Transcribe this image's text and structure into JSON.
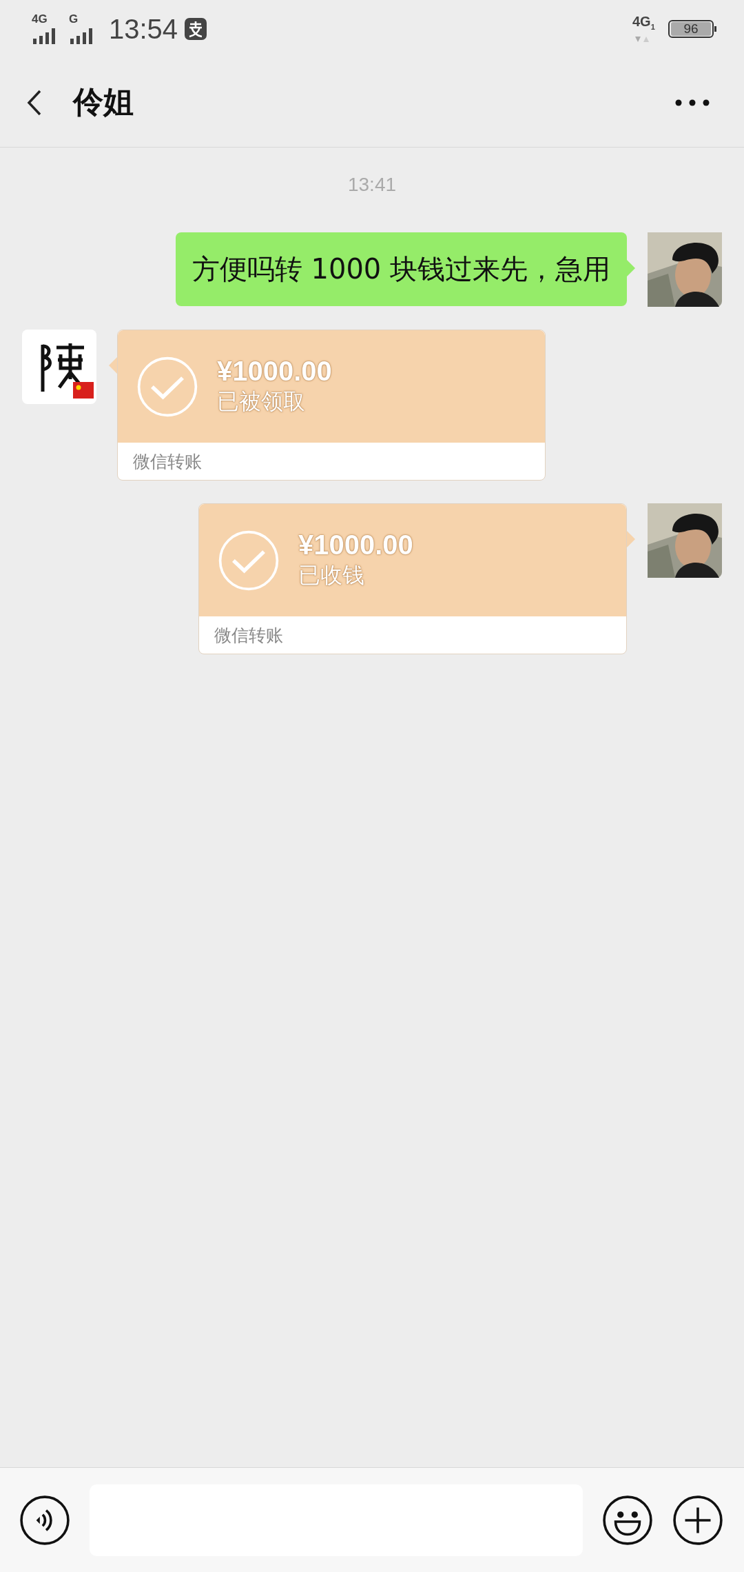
{
  "status_bar": {
    "network_1": "4G",
    "network_2": "G",
    "time": "13:54",
    "network_right": "4G",
    "network_right_sub": "1",
    "battery": "96"
  },
  "header": {
    "title": "伶姐"
  },
  "timestamp": "13:41",
  "messages": [
    {
      "kind": "text",
      "outgoing": true,
      "text": "方便吗转 1000 块钱过来先，急用"
    },
    {
      "kind": "transfer",
      "outgoing": false,
      "amount": "¥1000.00",
      "status": "已被领取",
      "footer": "微信转账"
    },
    {
      "kind": "transfer",
      "outgoing": true,
      "amount": "¥1000.00",
      "status": "已收钱",
      "footer": "微信转账"
    }
  ]
}
